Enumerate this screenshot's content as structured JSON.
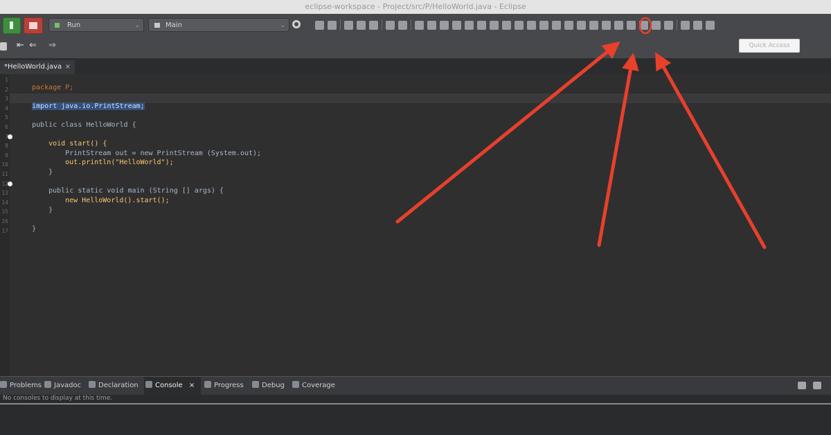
{
  "window": {
    "title": "eclipse-workspace - Project/src/P/HelloWorld.java - Eclipse"
  },
  "toolbar": {
    "run_config": "Run",
    "target": "Main",
    "quick_access_placeholder": "Quick Access"
  },
  "editor_tab": {
    "label": "*HelloWorld.java",
    "close": "×"
  },
  "editor": {
    "line_numbers": [
      "1",
      "2",
      "3",
      "4",
      "5",
      "6",
      "7",
      "8",
      "9",
      "10",
      "11",
      "12",
      "13",
      "14",
      "15",
      "16",
      "17"
    ],
    "lines": {
      "l1": "package P;",
      "l3_import": "import java.io.PrintStream;",
      "l5": "public class HelloWorld {",
      "l7": "void start() {",
      "l8": "PrintStream out = new PrintStream (System.out);",
      "l9": "out.println(\"HelloWorld\");",
      "l10": "}",
      "l12": "public static void main (String [] args) {",
      "l13": "new HelloWorld().start();",
      "l14": "}",
      "l16": "}"
    }
  },
  "bottom_tabs": [
    {
      "label": "Problems"
    },
    {
      "label": "Javadoc"
    },
    {
      "label": "Declaration"
    },
    {
      "label": "Console",
      "active": true
    },
    {
      "label": "Progress"
    },
    {
      "label": "Debug"
    },
    {
      "label": "Coverage"
    }
  ],
  "console": {
    "message": "No consoles to display at this time."
  },
  "colors": {
    "arrow": "#e8402b",
    "background": "#2f2f30",
    "toolbar": "#46484b"
  },
  "icons": [
    "run-icon",
    "stop-icon",
    "gear-icon",
    "close-icon",
    "chevron-down-icon"
  ]
}
